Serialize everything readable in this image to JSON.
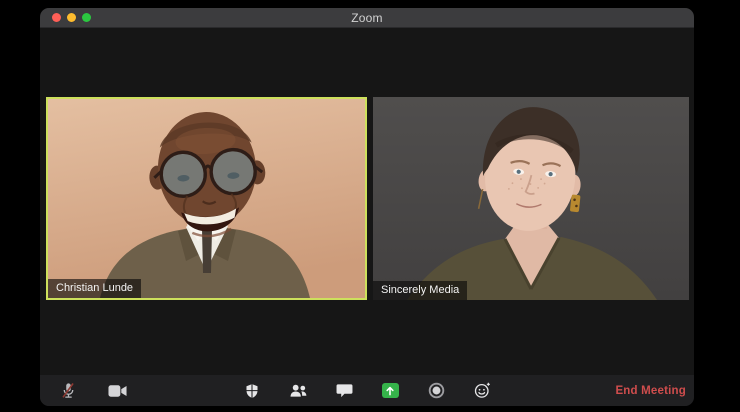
{
  "window": {
    "title": "Zoom"
  },
  "titlebar_controls": {
    "close_color": "#ff5f57",
    "minimize_color": "#febc2e",
    "fullscreen_color": "#2bc840"
  },
  "participants": [
    {
      "name": "Christian Lunde",
      "active_speaker": true
    },
    {
      "name": "Sincerely Media",
      "active_speaker": false
    }
  ],
  "toolbar": {
    "buttons": [
      {
        "id": "mute",
        "icon": "microphone-muted-icon",
        "state": "muted"
      },
      {
        "id": "video",
        "icon": "video-camera-icon",
        "state": "on"
      },
      {
        "id": "security",
        "icon": "security-shield-icon"
      },
      {
        "id": "participants",
        "icon": "participants-icon"
      },
      {
        "id": "chat",
        "icon": "chat-bubble-icon"
      },
      {
        "id": "share-screen",
        "icon": "share-screen-icon",
        "color": "#35b34a"
      },
      {
        "id": "record",
        "icon": "record-icon"
      },
      {
        "id": "reactions",
        "icon": "reactions-smiley-icon"
      }
    ],
    "end_meeting_label": "End Meeting"
  },
  "colors": {
    "active_speaker_border": "#cde05c",
    "end_meeting_red": "#cf4d4d",
    "share_screen_green": "#35b34a",
    "titlebar_bg": "#3c3c3e",
    "toolbar_bg": "#202022",
    "window_bg": "#161616"
  }
}
